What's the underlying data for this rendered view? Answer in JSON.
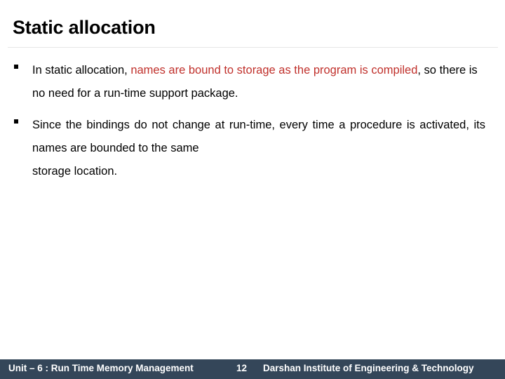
{
  "slide": {
    "title": "Static allocation",
    "background_color": "#ffffff",
    "accent_red": "#c0302b",
    "footer_background_color": "#344659",
    "divider_color": "#e6e6e6"
  },
  "bullets": [
    {
      "marker": "square-bullet-icon",
      "segments": [
        {
          "text": "In static allocation, ",
          "color": "black"
        },
        {
          "text": "names are bound to storage as the program is compiled",
          "color": "red"
        },
        {
          "text": ", so there is no need for a run-time support package.",
          "color": "black"
        }
      ]
    },
    {
      "marker": "square-bullet-icon",
      "segments": [
        {
          "text": "Since the bindings do not change at run-time, every time a procedure is activated, its names are bounded to the same ",
          "color": "black"
        },
        {
          "text": "storage location.",
          "color": "black"
        }
      ]
    }
  ],
  "footer": {
    "unit_label": "Unit – 6 : Run Time Memory Management",
    "page_number": "12",
    "organization": "Darshan Institute of Engineering & Technology"
  }
}
